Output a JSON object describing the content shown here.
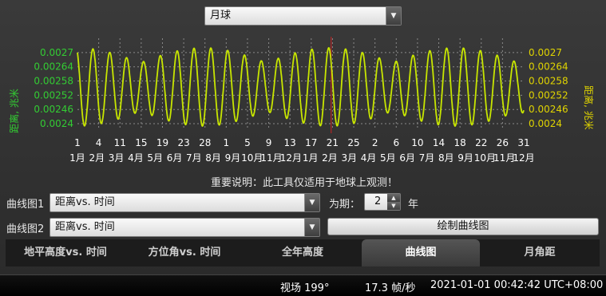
{
  "body_selector": {
    "value": "月球"
  },
  "chart_data": {
    "type": "line",
    "ylabel_left": "距离, 兆米",
    "ylabel_right": "距离, 兆米",
    "y_ticks": [
      "0.0027",
      "0.00264",
      "0.00258",
      "0.00252",
      "0.00246",
      "0.0024"
    ],
    "ylim": [
      0.00238,
      0.00274
    ],
    "x_ticks_day": [
      "1",
      "4",
      "11",
      "15",
      "19",
      "23",
      "28",
      "1",
      "5",
      "9",
      "13",
      "17",
      "21",
      "25",
      "2",
      "6",
      "10",
      "14",
      "18",
      "22",
      "26",
      "31"
    ],
    "x_ticks_month": [
      "1月",
      "2月",
      "3月",
      "4月",
      "5月",
      "6月",
      "7月",
      "8月",
      "9月",
      "10月",
      "11月",
      "12月",
      "1月",
      "2月",
      "3月",
      "4月",
      "5月",
      "6月",
      "7月",
      "8月",
      "9月",
      "10月",
      "11月",
      "12月"
    ],
    "xlim_days": [
      0,
      730
    ],
    "current_date_marker_day": 415,
    "series": [
      {
        "color": "#c8e600",
        "period_days": 27.55,
        "min": 0.00239,
        "max": 0.00272
      }
    ],
    "grid": true
  },
  "notice": "重要说明：此工具仅适用于地球上观测！",
  "graph1": {
    "label": "曲线图1",
    "value": "距离vs. 时间"
  },
  "graph2": {
    "label": "曲线图2",
    "value": "距离vs. 时间"
  },
  "period": {
    "label": "为期：",
    "value": "2",
    "unit": "年"
  },
  "draw_button": "绘制曲线图",
  "tabs": [
    {
      "label": "地平高度vs. 时间"
    },
    {
      "label": "方位角vs. 时间"
    },
    {
      "label": "全年高度"
    },
    {
      "label": "曲线图",
      "active": true
    },
    {
      "label": "月角距"
    }
  ],
  "statusbar": {
    "fov": "视场 199°",
    "fps": "17.3 帧/秒",
    "datetime": "2021-01-01 00:42:42 UTC+08:00"
  },
  "colors": {
    "left_axis": "#33cc33",
    "right_axis": "#e0d400",
    "curve": "#c8e600",
    "marker": "#cc2222"
  }
}
